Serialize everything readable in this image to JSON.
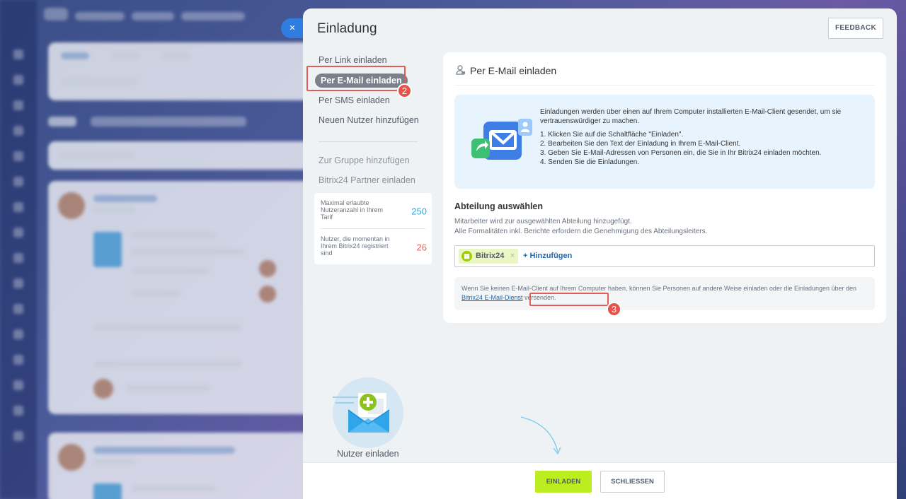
{
  "slider": {
    "title": "Einladung",
    "feedback_label": "FEEDBACK",
    "close_glyph": "×"
  },
  "nav": {
    "items": [
      {
        "label": "Per Link einladen"
      },
      {
        "label": "Per E-Mail einladen",
        "active": true
      },
      {
        "label": "Per SMS einladen"
      },
      {
        "label": "Neuen Nutzer hinzufügen"
      }
    ],
    "secondary": [
      {
        "label": "Zur Gruppe hinzufügen"
      },
      {
        "label": "Bitrix24 Partner einladen"
      }
    ]
  },
  "limits": {
    "max_label": "Maximal erlaubte Nutzeranzahl in Ihrem Tarif",
    "max_value": "250",
    "current_label": "Nutzer, die momentan in Ihrem Bitrix24 registriert sind",
    "current_value": "26"
  },
  "annotations": {
    "badge_2": "2",
    "badge_3": "3"
  },
  "card": {
    "header": "Per E-Mail einladen",
    "info_intro": "Einladungen werden über einen auf Ihrem Computer installierten E-Mail-Client gesendet, um sie vertrauenswürdiger zu machen.",
    "steps": [
      "1. Klicken Sie auf die Schaltfläche \"Einladen\".",
      "2. Bearbeiten Sie den Text der Einladung in Ihrem E-Mail-Client.",
      "3. Geben Sie E-Mail-Adressen von Personen ein, die Sie in Ihr Bitrix24 einladen möchten.",
      "4. Senden Sie die Einladungen."
    ],
    "section_title": "Abteilung auswählen",
    "section_desc_1": "Mitarbeiter wird zur ausgewählten Abteilung hinzugefügt.",
    "section_desc_2": "Alle Formalitäten inkl. Berichte erfordern die Genehmigung des Abteilungsleiters.",
    "department_tag": "Bitrix24",
    "add_label": "+ Hinzufügen",
    "note_before": "Wenn Sie keinen E-Mail-Client auf Ihrem Computer haben, können Sie Personen auf andere Weise einladen oder die Einladungen über den ",
    "note_link": "Bitrix24 E-Mail-Dienst",
    "note_after": " versenden."
  },
  "illustration": {
    "caption": "Nutzer einladen"
  },
  "footer": {
    "invite_label": "EINLADEN",
    "close_label": "SCHLIESSEN"
  },
  "colors": {
    "accent_green": "#bbed21",
    "link_blue": "#2067b0",
    "highlight_red": "#e45c57",
    "limit_blue": "#2fa6d8",
    "limit_red": "#f0605a"
  }
}
